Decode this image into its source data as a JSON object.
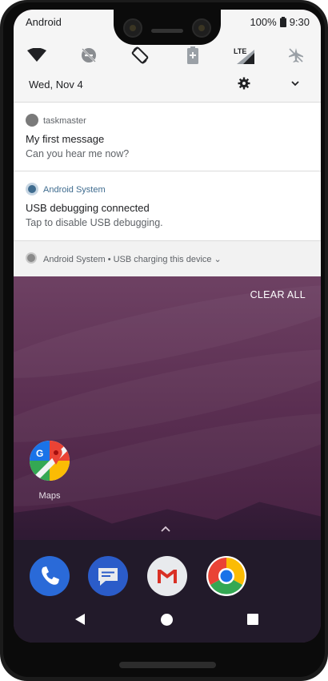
{
  "status_bar": {
    "carrier": "Android",
    "battery": "100%",
    "time": "9:30"
  },
  "quick_settings": {
    "tiles": [
      {
        "name": "wifi-icon"
      },
      {
        "name": "do-not-disturb-icon"
      },
      {
        "name": "auto-rotate-icon"
      },
      {
        "name": "battery-saver-icon"
      },
      {
        "name": "lte-signal-icon",
        "text": "LTE"
      },
      {
        "name": "airplane-mode-icon"
      }
    ],
    "date": "Wed, Nov 4"
  },
  "notifications": [
    {
      "app": "taskmaster",
      "title": "My first message",
      "text": "Can you hear me now?"
    },
    {
      "app": "Android System",
      "title": "USB debugging connected",
      "text": "Tap to disable USB debugging."
    }
  ],
  "summary": {
    "text": "Android System • USB charging this device ⌄"
  },
  "clear_all": "CLEAR ALL",
  "home": {
    "maps_label": "Maps",
    "dock": [
      "phone-app-icon",
      "messages-app-icon",
      "gmail-app-icon",
      "chrome-app-icon"
    ]
  },
  "colors": {
    "accent_system": "#3f6c8f",
    "wallpaper": "#5b2f52"
  }
}
